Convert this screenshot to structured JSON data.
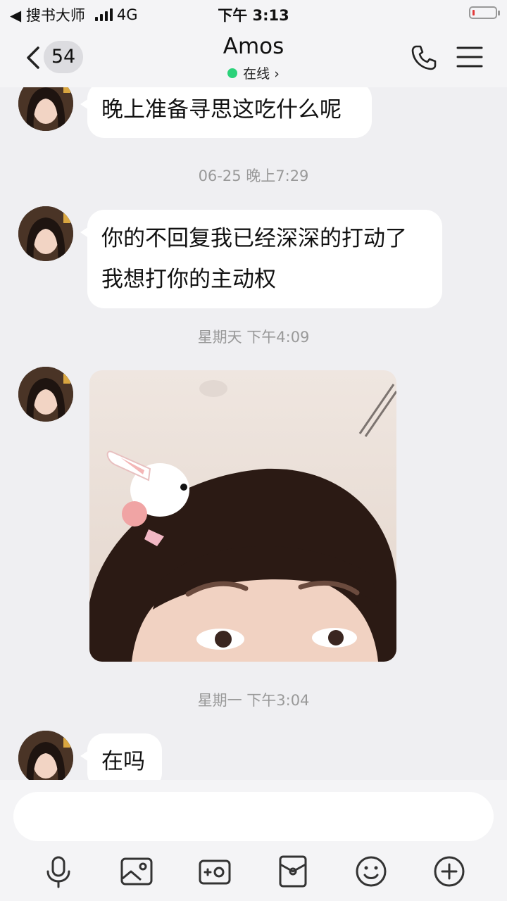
{
  "status_bar": {
    "back_app": "◀ 搜书大师",
    "network": "4G",
    "time": "下午 3:13"
  },
  "nav": {
    "unread_count": "54",
    "contact_name": "Amos",
    "online_status": "在线 ›"
  },
  "messages": [
    {
      "type": "text",
      "text": "晚上准备寻思这吃什么呢"
    },
    {
      "type": "timestamp",
      "text": "06-25 晚上7:29"
    },
    {
      "type": "text",
      "lines": [
        "你的不回复我已经深深的打动了",
        "我想打你的主动权"
      ]
    },
    {
      "type": "timestamp",
      "text": "星期天 下午4:09"
    },
    {
      "type": "image"
    },
    {
      "type": "timestamp",
      "text": "星期一 下午3:04"
    },
    {
      "type": "text",
      "text": "在吗"
    }
  ],
  "input": {
    "placeholder": ""
  },
  "toolbar": {
    "icons": [
      "microphone-icon",
      "image-icon",
      "camera-icon",
      "red-packet-icon",
      "emoji-icon",
      "plus-icon"
    ]
  },
  "colors": {
    "online": "#2bd27a",
    "bubble": "#ffffff",
    "background": "#efeff2",
    "battery_low": "#e23b3b"
  }
}
